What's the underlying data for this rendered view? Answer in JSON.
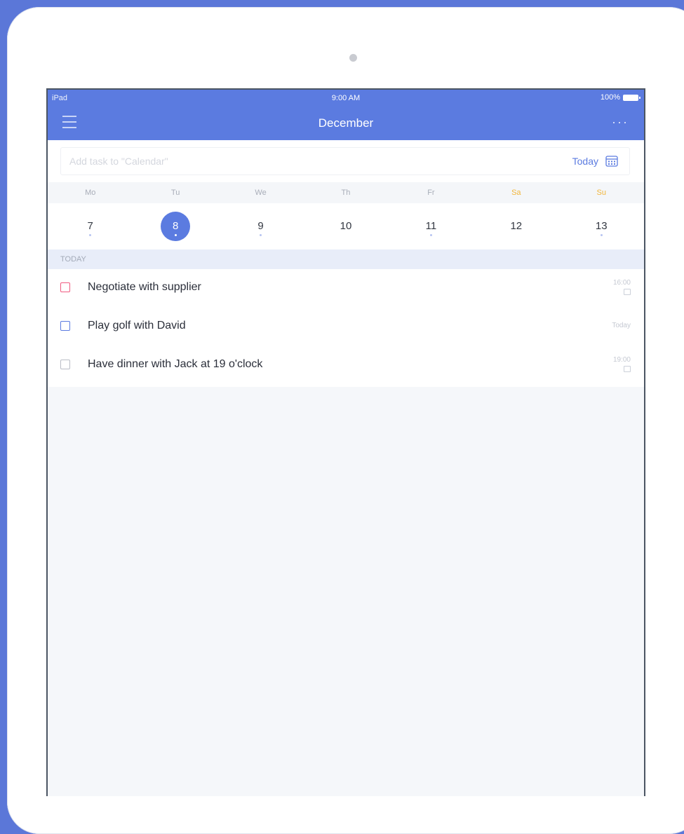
{
  "status": {
    "device": "iPad",
    "time": "9:00 AM",
    "battery": "100%"
  },
  "nav": {
    "title": "December",
    "more": "···"
  },
  "add_task": {
    "placeholder": "Add task to \"Calendar\"",
    "today_label": "Today"
  },
  "weekdays": [
    "Mo",
    "Tu",
    "We",
    "Th",
    "Fr",
    "Sa",
    "Su"
  ],
  "dates": [
    "7",
    "8",
    "9",
    "10",
    "11",
    "12",
    "13"
  ],
  "selected_date": "8",
  "section": {
    "label": "TODAY"
  },
  "tasks": [
    {
      "title": "Negotiate with supplier",
      "meta": "16:00",
      "check_color": "#f05a80"
    },
    {
      "title": "Play golf with David",
      "meta": "Today",
      "check_color": "#5b7be0"
    },
    {
      "title": "Have dinner with Jack at 19 o'clock",
      "meta": "19:00",
      "check_color": "#b9bdc6"
    }
  ],
  "colors": {
    "accent": "#5b7be0",
    "weekend": "#f2b63b",
    "background": "#5b77d8"
  }
}
